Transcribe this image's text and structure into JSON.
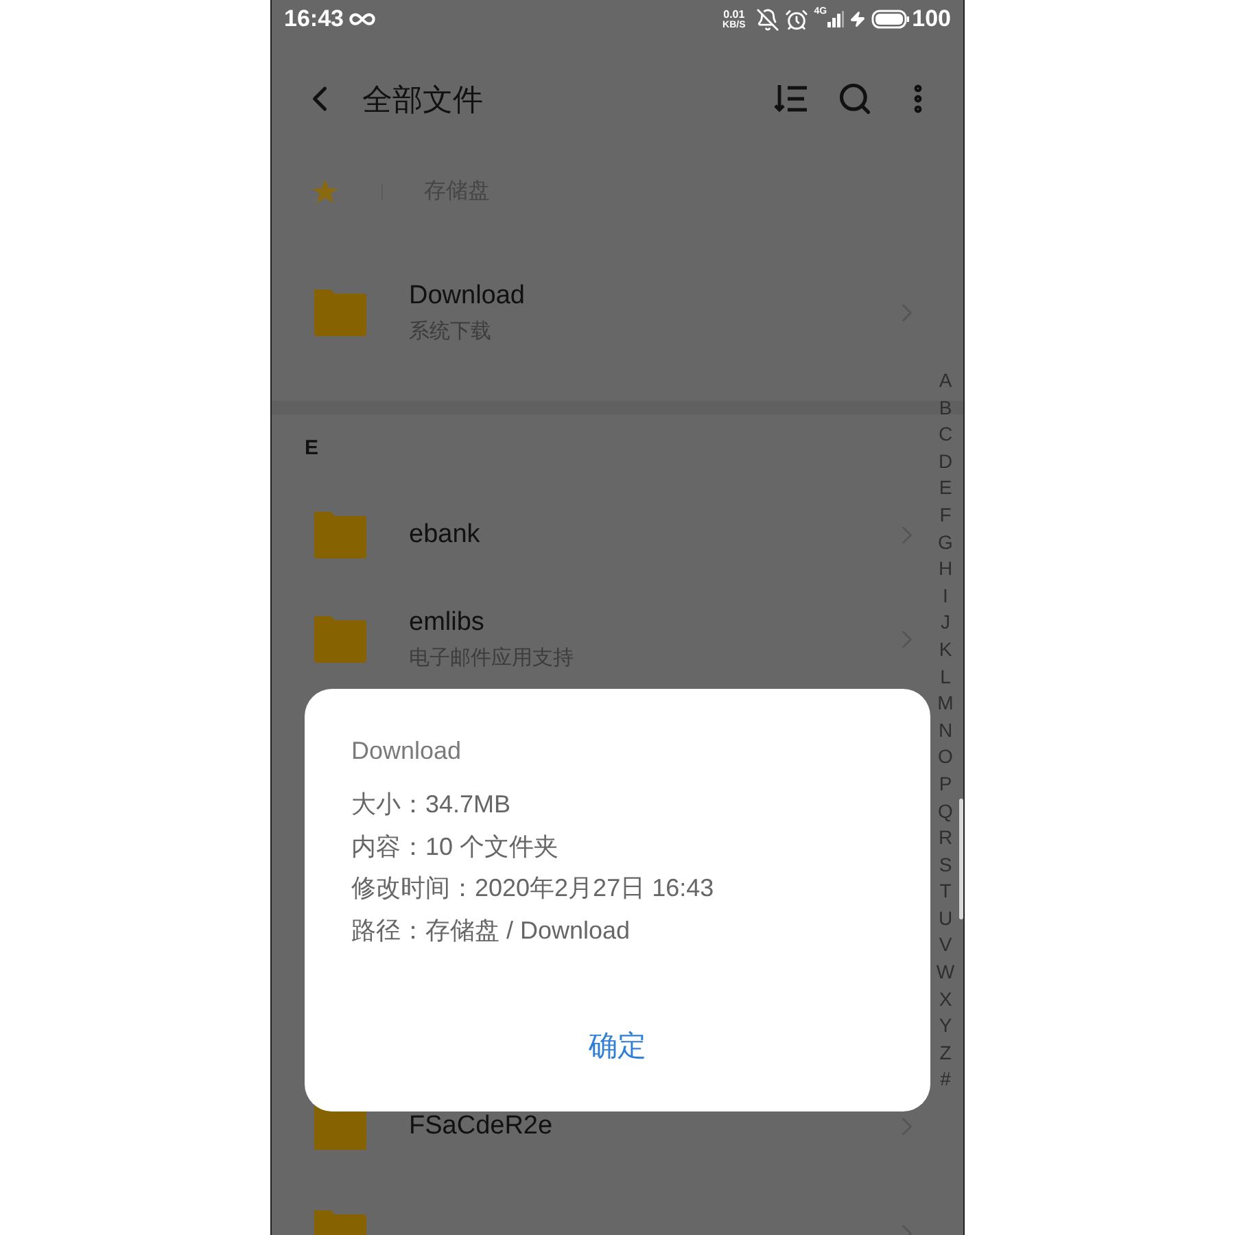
{
  "status_bar": {
    "time": "16:43",
    "net_speed_value": "0.01",
    "net_speed_unit": "KB/S",
    "network_type": "4G",
    "battery": "100"
  },
  "header": {
    "title": "全部文件"
  },
  "breadcrumb": {
    "items": [
      "存储盘"
    ]
  },
  "pinned": [
    {
      "name": "Download",
      "subtitle": "系统下载"
    }
  ],
  "sections": [
    {
      "letter": "E",
      "items": [
        {
          "name": "ebank"
        },
        {
          "name": "emlibs",
          "subtitle": "电子邮件应用支持"
        }
      ]
    }
  ],
  "lower_items": [
    {
      "kind": "folder",
      "name": "FSaCdeR2e"
    },
    {
      "kind": "folder"
    }
  ],
  "index_letters": [
    "A",
    "B",
    "C",
    "D",
    "E",
    "F",
    "G",
    "H",
    "I",
    "J",
    "K",
    "L",
    "M",
    "N",
    "O",
    "P",
    "Q",
    "R",
    "S",
    "T",
    "U",
    "V",
    "W",
    "X",
    "Y",
    "Z",
    "#"
  ],
  "dialog": {
    "title": "Download",
    "lines": [
      "大小：34.7MB",
      "内容：10 个文件夹",
      "修改时间：2020年2月27日 16:43",
      "路径：存储盘 / Download"
    ],
    "button": "确定"
  }
}
